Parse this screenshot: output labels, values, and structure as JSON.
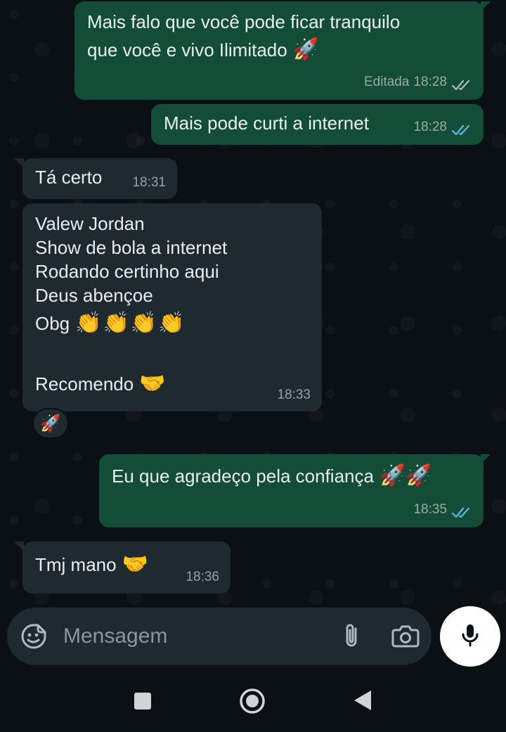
{
  "messages": [
    {
      "direction": "out",
      "lines": [
        "Mais falo que você  pode ficar tranquilo",
        "que você e vivo Ilimitado"
      ],
      "emoji": "🚀",
      "edited_label": "Editada",
      "time": "18:28",
      "ticks": "grey"
    },
    {
      "direction": "out",
      "lines": [
        "Mais pode curti a internet"
      ],
      "time": "18:28",
      "ticks": "blue"
    },
    {
      "direction": "in",
      "lines": [
        "Tá certo"
      ],
      "time": "18:31"
    },
    {
      "direction": "in",
      "lines": [
        "Valew Jordan",
        "Show de bola a internet",
        "Rodando certinho aqui",
        "Deus abençoe",
        "Obg",
        "",
        "Recomendo"
      ],
      "emoji_obg": "👏👏👏👏",
      "emoji_recomendo": "🤝",
      "time": "18:33",
      "reaction": "🚀"
    },
    {
      "direction": "out",
      "lines": [
        "Eu que agradeço pela confiança"
      ],
      "emoji": "🚀🚀",
      "time": "18:35",
      "ticks": "blue"
    },
    {
      "direction": "in",
      "lines": [
        "Tmj mano"
      ],
      "emoji": "🤝",
      "time": "18:36"
    }
  ],
  "composer": {
    "placeholder": "Mensagem",
    "icons": [
      "sticker-icon",
      "paperclip-icon",
      "camera-icon",
      "microphone-icon"
    ]
  },
  "colors": {
    "outgoing_bubble": "#144d37",
    "incoming_bubble": "#1f2a30",
    "read_tick": "#53bdeb",
    "background": "#0b1014"
  }
}
